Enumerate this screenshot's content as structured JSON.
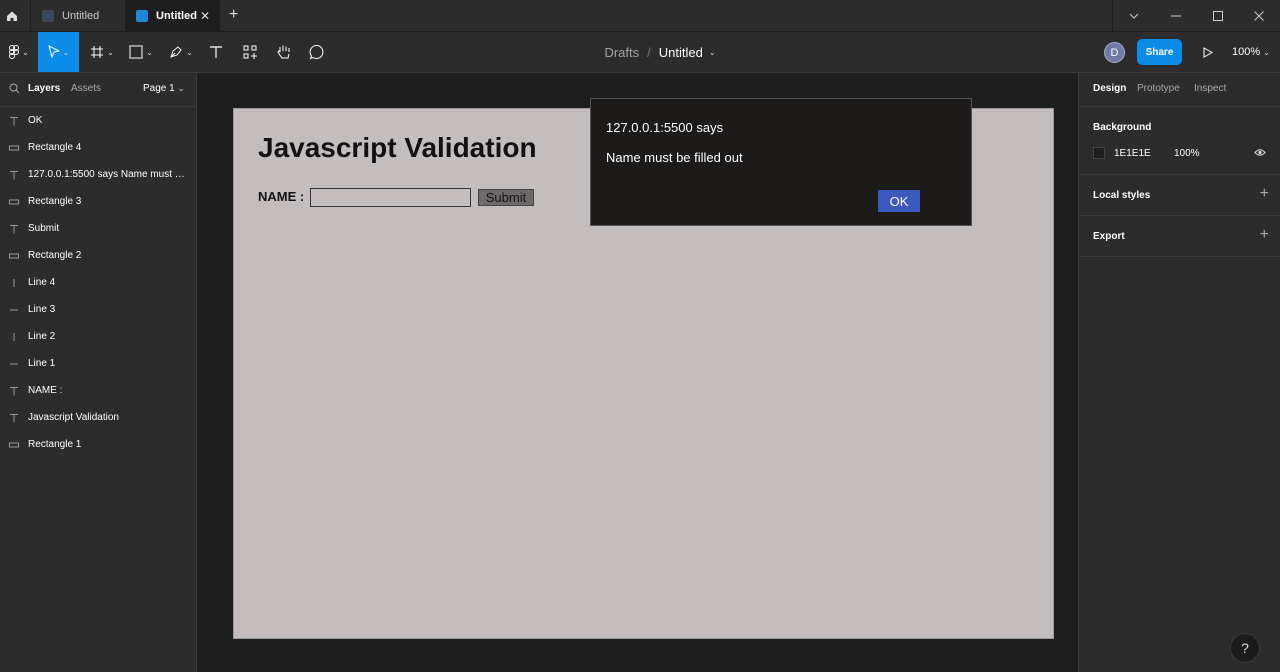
{
  "tabs": [
    {
      "label": "Untitled"
    },
    {
      "label": "Untitled",
      "close": "✕"
    }
  ],
  "tab_add": "+",
  "window_controls": {
    "dropdown": "⌄",
    "minimize": "—",
    "maximize": "☐",
    "close": "✕"
  },
  "breadcrumb": {
    "folder": "Drafts",
    "separator": "/",
    "file": "Untitled"
  },
  "user": {
    "avatar_initial": "D"
  },
  "toolbar": {
    "share_label": "Share",
    "zoom": "100%"
  },
  "left_panel": {
    "tabs": {
      "layers": "Layers",
      "assets": "Assets"
    },
    "page": "Page 1",
    "layers": [
      {
        "name": "OK",
        "icon": "text-icon"
      },
      {
        "name": "Rectangle 4",
        "icon": "rectangle-icon"
      },
      {
        "name": "127.0.0.1:5500 says Name must be filled out",
        "icon": "text-icon"
      },
      {
        "name": "Rectangle 3",
        "icon": "rectangle-icon"
      },
      {
        "name": "Submit",
        "icon": "text-icon"
      },
      {
        "name": "Rectangle 2",
        "icon": "rectangle-icon"
      },
      {
        "name": "Line 4",
        "icon": "line-vertical-icon"
      },
      {
        "name": "Line 3",
        "icon": "line-horizontal-icon"
      },
      {
        "name": "Line 2",
        "icon": "line-vertical-icon"
      },
      {
        "name": "Line 1",
        "icon": "line-horizontal-icon"
      },
      {
        "name": "NAME :",
        "icon": "text-icon"
      },
      {
        "name": "Javascript Validation",
        "icon": "text-icon"
      },
      {
        "name": "Rectangle 1",
        "icon": "rectangle-icon"
      }
    ]
  },
  "right_panel": {
    "tabs": {
      "design": "Design",
      "prototype": "Prototype",
      "inspect": "Inspect"
    },
    "background": {
      "title": "Background",
      "hex": "1E1E1E",
      "opacity": "100%"
    },
    "local_styles": "Local styles",
    "export": "Export"
  },
  "canvas": {
    "title": "Javascript Validation",
    "name_label": "NAME :",
    "submit_label": "Submit",
    "dialog": {
      "title": "127.0.0.1:5500 says",
      "message": "Name must be filled out",
      "ok": "OK"
    }
  },
  "help": "?",
  "colors": {
    "accent": "#0c8ce9",
    "frame_bg": "#c3bebd",
    "dialog_bg": "#1d1a1a",
    "ok_button": "#3d58bc"
  }
}
